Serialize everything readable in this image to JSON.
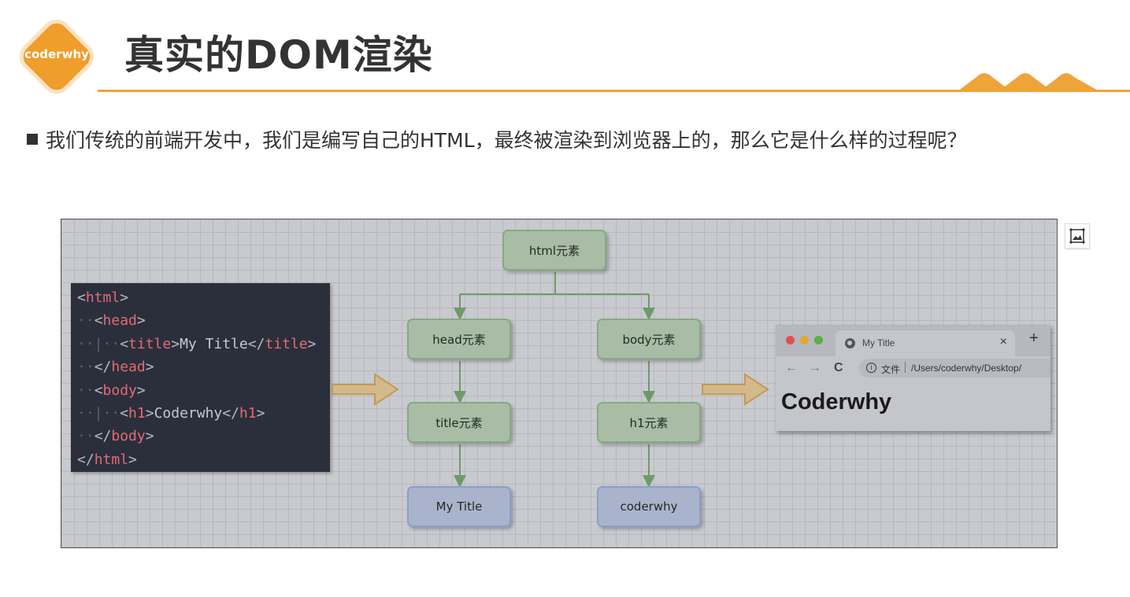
{
  "logo": {
    "text": "coderwhy"
  },
  "page": {
    "title": "真实的DOM渲染"
  },
  "bullet": {
    "text": "我们传统的前端开发中，我们是编写自己的HTML，最终被渲染到浏览器上的，那么它是什么样的过程呢？"
  },
  "figure": {
    "code": {
      "html_open": "html",
      "head_open": "head",
      "title_open": "title",
      "title_text": "My Title",
      "title_close": "title",
      "head_close": "head",
      "body_open": "body",
      "h1_open": "h1",
      "h1_text": "Coderwhy",
      "h1_close": "h1",
      "body_close": "body",
      "html_close": "html"
    },
    "tree": {
      "html": "html元素",
      "head": "head元素",
      "body": "body元素",
      "title": "title元素",
      "h1": "h1元素",
      "title_text": "My Title",
      "h1_text": "coderwhy"
    },
    "browser": {
      "tab_title": "My Title",
      "tab_close": "×",
      "new_tab": "+",
      "back": "←",
      "forward": "→",
      "reload": "C",
      "info": "i",
      "address_label": "文件",
      "address_url": "/Users/coderwhy/Desktop/",
      "content_heading": "Coderwhy"
    }
  },
  "colors": {
    "accent": "#efa43a",
    "node_green": "#a9bda6",
    "node_blue": "#a9b4cc",
    "code_bg": "#2b2f3b",
    "code_tag": "#e06c75"
  }
}
